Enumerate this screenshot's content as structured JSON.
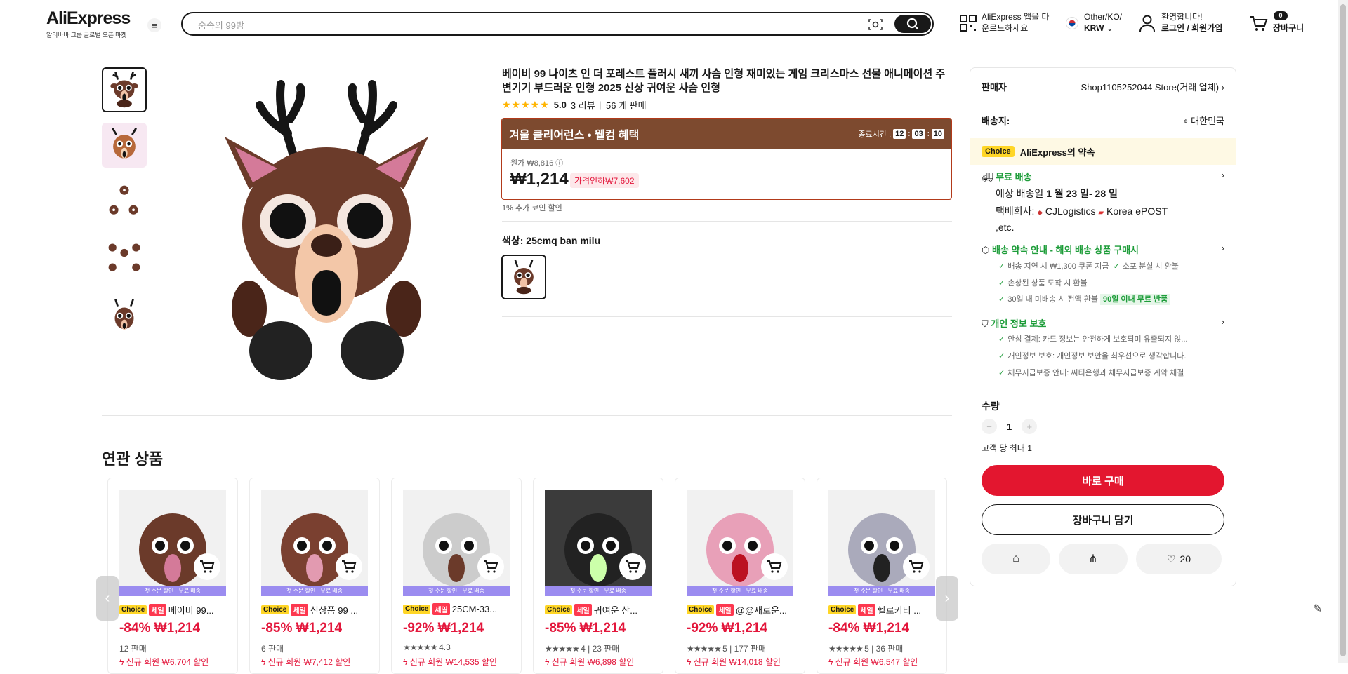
{
  "header": {
    "logo": "AliExpress",
    "logo_sub": "알리바바 그룹 글로벌 오픈 마켓",
    "search_placeholder": "숨속의 99밤",
    "app_line1": "AliExpress 앱을 다",
    "app_line2": "운로드하세요",
    "locale_line1": "Other/KO/",
    "locale_line2": "KRW",
    "user_line1": "환영합니다!",
    "user_line2": "로그인 / 회원가입",
    "cart_count": "0",
    "cart_label": "장바구니"
  },
  "product": {
    "title": "베이비 99 나이츠 인 더 포레스트 플러시 새끼 사슴 인형 재미있는 게임 크리스마스 선물 애니메이션 주변기기 부드러운 인형 2025 신상 귀여운 사슴 인형",
    "rating": "5.0",
    "reviews": "3 리뷰",
    "sold": "56 개 판매",
    "promo_title": "겨울 클리어런스 • 웰컴 혜택",
    "countdown_label": "종료시간 :",
    "cd_h": "12",
    "cd_m": "03",
    "cd_s": "10",
    "orig_label": "원가",
    "orig_price": "₩8,816",
    "price": "₩1,214",
    "discount": "가격인하₩7,602",
    "coin": "1% 추가 코인 할인",
    "color_label": "색상: 25cmq ban milu"
  },
  "panel": {
    "seller_label": "판매자",
    "seller_name": "Shop1105252044 Store(거래 업체)",
    "ship_to_label": "배송지:",
    "ship_to": "대한민국",
    "choice_badge": "Choice",
    "choice_text": "AliExpress의 약속",
    "free_ship": "무료 배송",
    "eta_prefix": "예상 배송일",
    "eta": "1 월 23 일- 28 일",
    "carrier_label": "택배회사:",
    "carrier1": "CJLogistics",
    "carrier2": "Korea",
    "carrier3": "ePOST ,etc.",
    "promise_title": "배송 약속 안내 - 해외 배송 상품 구매시",
    "promise1": "배송 지연 시 ₩1,300 쿠폰 지급",
    "promise2": "소포 분실 시 환불",
    "promise3": "손상된 상품 도착 시 환불",
    "promise4": "30일 내 미배송 시 전액 환불",
    "promise4_badge": "90일 이내 무료 반품",
    "privacy_title": "개인 정보 보호",
    "privacy1": "안심 결제: 카드 정보는 안전하게 보호되며 유출되지 않...",
    "privacy2": "개인정보 보호: 개인정보 보안을 최우선으로 생각합니다.",
    "privacy3": "채무지급보증 안내: 씨티은행과 채무지급보증 계약 체결",
    "qty_label": "수량",
    "qty_value": "1",
    "qty_limit": "고객 당 최대 1",
    "buy_now": "바로 구매",
    "add_cart": "장바구니 담기",
    "wish_count": "20"
  },
  "related": {
    "title": "연관 상품",
    "band": "첫 주문 할인 · 무료 배송",
    "choice": "Choice",
    "sale": "세일",
    "items": [
      {
        "name": "베이비 99...",
        "price": "-84% ₩1,214",
        "sold": "12 판매",
        "new": "신규 회원 ₩6,704 할인"
      },
      {
        "name": "신상품 99 ...",
        "price": "-85% ₩1,214",
        "sold": "6 판매",
        "new": "신규 회원 ₩7,412 할인"
      },
      {
        "name": "25CM-33...",
        "price": "-92% ₩1,214",
        "sold": "4.3",
        "new": "신규 회원 ₩14,535 할인"
      },
      {
        "name": "귀여운 산...",
        "price": "-85% ₩1,214",
        "sold": "4 | 23 판매",
        "new": "신규 회원 ₩6,898 할인"
      },
      {
        "name": "@@새로운...",
        "price": "-92% ₩1,214",
        "sold": "5 | 177 판매",
        "new": "신규 회원 ₩14,018 할인"
      },
      {
        "name": "헬로키티 ...",
        "price": "-84% ₩1,214",
        "sold": "5 | 36 판매",
        "new": "신규 회원 ₩6,547 할인"
      }
    ]
  }
}
